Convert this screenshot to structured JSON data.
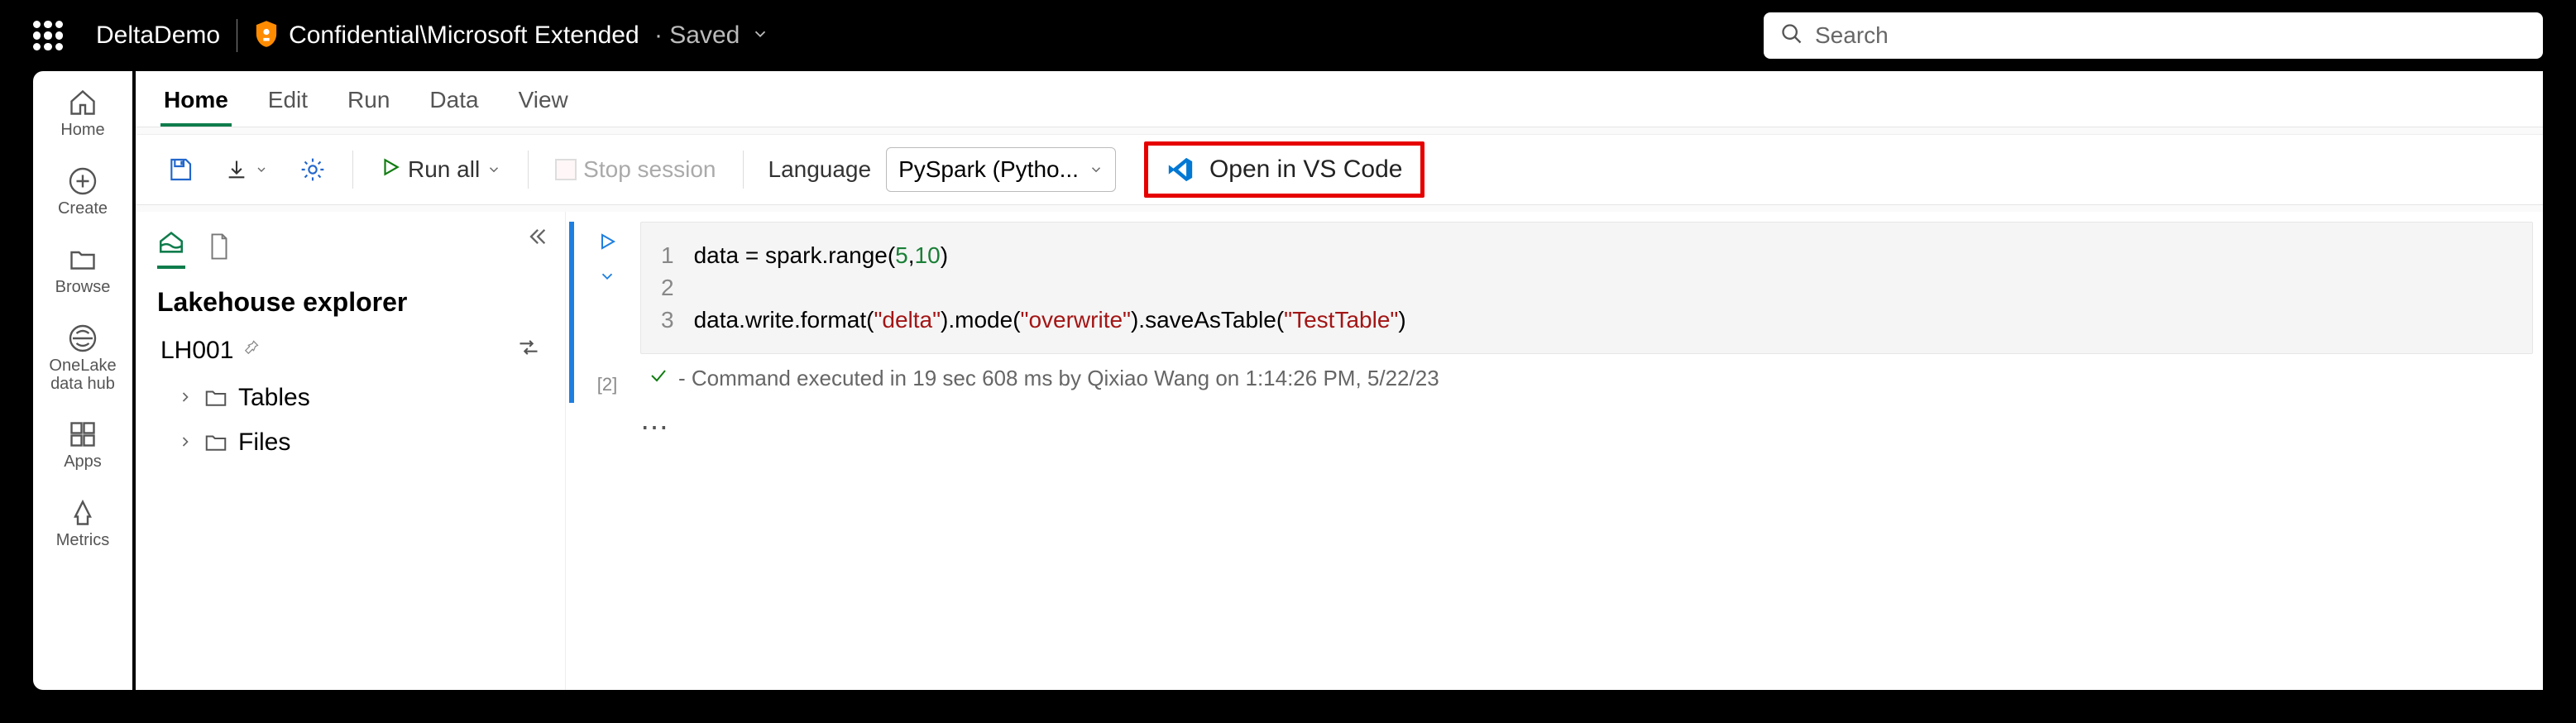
{
  "topbar": {
    "title": "DeltaDemo",
    "confidential": "Confidential\\Microsoft Extended",
    "saved": "Saved",
    "search_placeholder": "Search"
  },
  "left_rail": {
    "items": [
      {
        "label": "Home"
      },
      {
        "label": "Create"
      },
      {
        "label": "Browse"
      },
      {
        "label": "OneLake data hub"
      },
      {
        "label": "Apps"
      },
      {
        "label": "Metrics"
      }
    ]
  },
  "ribbon": {
    "tabs": [
      "Home",
      "Edit",
      "Run",
      "Data",
      "View"
    ],
    "active": 0
  },
  "toolbar": {
    "run_all": "Run all",
    "stop_session": "Stop session",
    "language_label": "Language",
    "language_value": "PySpark (Pytho...",
    "open_vscode": "Open in VS Code"
  },
  "explorer": {
    "title": "Lakehouse explorer",
    "lakehouse": "LH001",
    "nodes": [
      {
        "label": "Tables"
      },
      {
        "label": "Files"
      }
    ]
  },
  "cell": {
    "exec_count": "[2]",
    "line_nums": [
      "1",
      "2",
      "3"
    ],
    "code": {
      "l1_a": "data = spark.range(",
      "l1_n1": "5",
      "l1_c": ",",
      "l1_n2": "10",
      "l1_b": ")",
      "l3_a": "data.write.format(",
      "l3_s1": "\"delta\"",
      "l3_b": ").mode(",
      "l3_s2": "\"overwrite\"",
      "l3_c": ").saveAsTable(",
      "l3_s3": "\"TestTable\"",
      "l3_d": ")"
    },
    "status": "- Command executed in 19 sec 608 ms by Qixiao Wang on 1:14:26 PM, 5/22/23"
  }
}
